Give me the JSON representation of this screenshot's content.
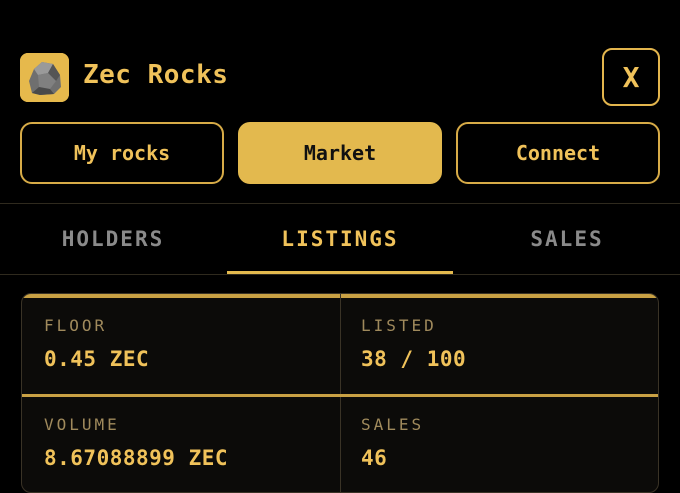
{
  "app": {
    "title": "Zec Rocks",
    "logo_icon": "rock-icon",
    "close_label": "X"
  },
  "nav": {
    "my_rocks": "My rocks",
    "market": "Market",
    "connect": "Connect",
    "active": "Market"
  },
  "tabs": {
    "holders": "HOLDERS",
    "listings": "LISTINGS",
    "sales": "SALES",
    "active": "LISTINGS"
  },
  "stats": {
    "floor_label": "FLOOR",
    "floor_value": "0.45 ZEC",
    "listed_label": "LISTED",
    "listed_value": "38 / 100",
    "volume_label": "VOLUME",
    "volume_value": "8.67088899 ZEC",
    "sales_label": "SALES",
    "sales_value": "46"
  },
  "colors": {
    "background": "#000000",
    "accent": "#e3b94e",
    "text_gold": "#f0c25a",
    "muted": "#8a8a8a"
  }
}
